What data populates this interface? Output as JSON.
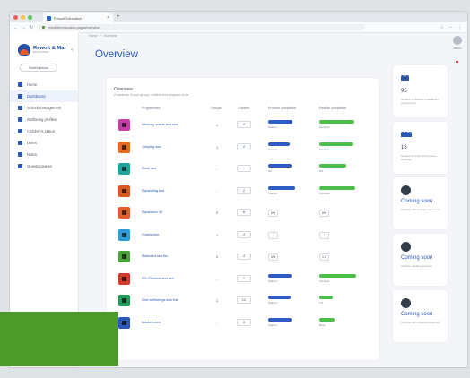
{
  "browser": {
    "tab_title": "Rewolt Education",
    "url": "rewolt-hn-education.pages/overview",
    "new_tab": "+",
    "close": "×"
  },
  "sidebar": {
    "logo_title": "Rewolt & Mai",
    "logo_sub": "EDUCATION",
    "switch_label": "Switch school",
    "items": [
      {
        "label": "Home",
        "active": false
      },
      {
        "label": "Dashboard",
        "active": true
      },
      {
        "label": "School management",
        "active": false
      },
      {
        "label": "Wellbeing profiles",
        "active": false
      },
      {
        "label": "Children's status",
        "active": false
      },
      {
        "label": "Users",
        "active": false
      },
      {
        "label": "Notes",
        "active": false
      },
      {
        "label": "Questionnaires",
        "active": false
      }
    ]
  },
  "header": {
    "breadcrumb": [
      "Home",
      "/",
      "Overview"
    ],
    "title": "Overview",
    "menu_label": "MENU"
  },
  "overview": {
    "title": "Overview",
    "subtitle": "A summary of your groups, children and progress so far",
    "columns": [
      "Programmes",
      "Groups",
      "Children",
      "Process completion",
      "Results completion"
    ],
    "rows": [
      {
        "name": "Memory, words and sea",
        "groups": "1",
        "children": "2",
        "color": "#c93da6",
        "p1": 0.62,
        "p1_label": "Started",
        "p2": 0.9,
        "p2_label": "Finished"
      },
      {
        "name": "Jumping sea",
        "groups": "1",
        "children": "2",
        "color": "#e86a1f",
        "p1": 0.55,
        "p1_label": "Started",
        "p2": 0.88,
        "p2_label": "Finished"
      },
      {
        "name": "Earth sea",
        "groups": "-",
        "children": "-",
        "color": "#1fa39a",
        "p1": 0.6,
        "p1_label": "0%",
        "p2": 0.7,
        "p2_label": "0%"
      },
      {
        "name": "Expanding sea",
        "groups": "-",
        "children": "2",
        "color": "#d95a1e",
        "p1": 0.7,
        "p1_label": "Started",
        "p2": 0.92,
        "p2_label": "Finished"
      },
      {
        "name": "Expansion 48",
        "groups": "2",
        "children": "6",
        "color": "#e25f2c",
        "p1": null,
        "p1_label": "0%",
        "p2": null,
        "p2_label": "0%"
      },
      {
        "name": "Champions",
        "groups": "1",
        "children": "4",
        "color": "#2b9cd8",
        "p1": null,
        "p1_label": "-",
        "p2": null,
        "p2_label": "-"
      },
      {
        "name": "Balanced sea fun",
        "groups": "2",
        "children": "4",
        "color": "#4aa43a",
        "p1": null,
        "p1_label": "3%",
        "p2": null,
        "p2_label": "1.5"
      },
      {
        "name": "EXCITement and sea",
        "groups": "-",
        "children": "1",
        "color": "#d23b2b",
        "p1": 0.6,
        "p1_label": "Started",
        "p2": 0.95,
        "p2_label": "Finished"
      },
      {
        "name": "New wellbeings sea tria",
        "groups": "1",
        "children": "12",
        "color": "#1f9c58",
        "p1": 0.58,
        "p1_label": "Started",
        "p2": 0.35,
        "p2_label": "1.5"
      },
      {
        "name": "Masters sea",
        "groups": "-",
        "children": "3",
        "color": "#2a58b8",
        "p1": 0.6,
        "p1_label": "Started",
        "p2": 0.4,
        "p2_label": "Busy"
      }
    ]
  },
  "stats": [
    {
      "value": "95",
      "desc": "Number of children in wellbeing programmes"
    },
    {
      "value": "16",
      "desc": "Number of supervised groups available"
    }
  ],
  "coming_soon": [
    {
      "label": "Coming soon",
      "desc": "Children with a recent evaluation"
    },
    {
      "label": "Coming soon",
      "desc": "Children needing attention"
    },
    {
      "label": "Coming soon",
      "desc": "Children with expected progress"
    }
  ],
  "colors": {
    "accent": "#2a58b8",
    "process_bar": "#2f5bc4",
    "results_bar": "#4cbf4a",
    "brand_green": "#4c9a2a"
  },
  "scroll_ticks": [
    "200",
    "800",
    "500",
    "100",
    "0"
  ]
}
